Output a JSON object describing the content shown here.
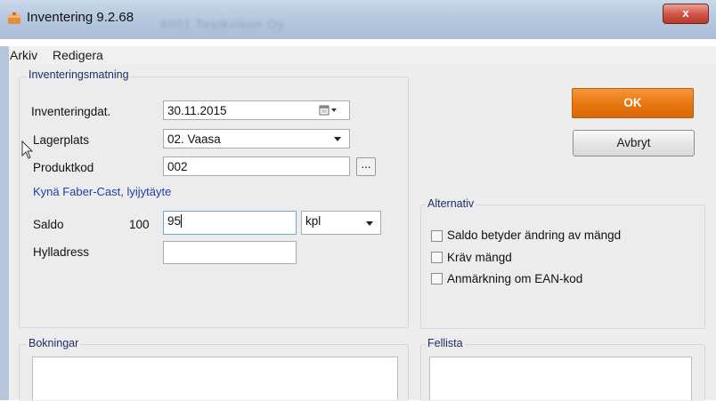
{
  "window": {
    "title": "Inventering 9.2.68",
    "blurred_text": "6001 Testkvikon Oy",
    "close_label": "x"
  },
  "menu": {
    "items": [
      "Arkiv",
      "Redigera"
    ]
  },
  "inventory_group": {
    "title": "Inventeringsmatning",
    "date_label": "Inventeringdat.",
    "date_value": "30.11.2015",
    "location_label": "Lagerplats",
    "location_value": "02. Vaasa",
    "product_label": "Produktkod",
    "product_value": "002",
    "browse_label": "...",
    "product_name": "Kynä Faber-Cast, lyijytäyte",
    "balance_label": "Saldo",
    "balance_value": "100",
    "quantity_value": "95",
    "unit_value": "kpl",
    "shelf_label": "Hylladress",
    "shelf_value": ""
  },
  "buttons": {
    "ok": "OK",
    "cancel": "Avbryt"
  },
  "options": {
    "title": "Alternativ",
    "items": [
      {
        "label": "Saldo betyder ändring av mängd",
        "checked": false
      },
      {
        "label": "Kräv mängd",
        "checked": false
      },
      {
        "label": "Anmärkning om EAN-kod",
        "checked": false
      }
    ]
  },
  "bookings": {
    "title": "Bokningar"
  },
  "errors": {
    "title": "Fellista"
  },
  "colors": {
    "ok_button": "#e8760f",
    "title_bar": "#b7c9df",
    "group_title": "#1d2f6b",
    "product_name": "#1f3fa8"
  }
}
